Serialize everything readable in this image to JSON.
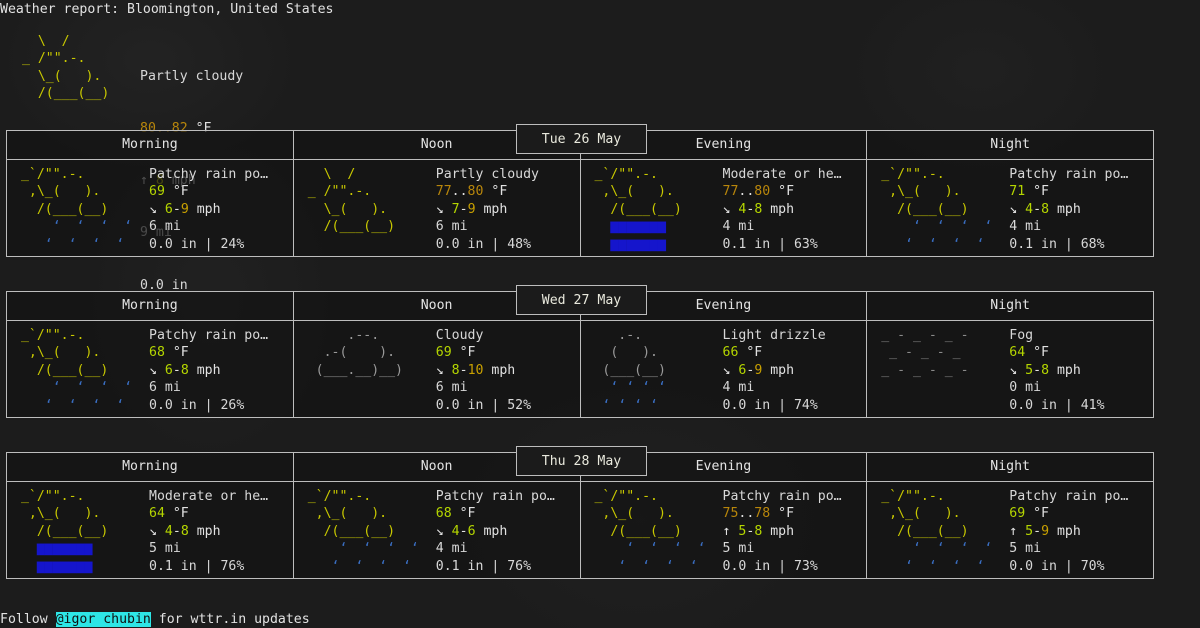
{
  "header": {
    "title": "Weather report: Bloomington, United States"
  },
  "current": {
    "art_lines": [
      "   \\  /",
      " _ /\"\".-.",
      "   \\_(   ).",
      "   /(___(__)",
      ""
    ],
    "condition": "Partly cloudy",
    "temp": "80..82",
    "temp_unit": "°F",
    "wind_arrow": "↑",
    "wind": "8",
    "wind_unit": "mph",
    "visibility": "9 mi",
    "precip": "0.0 in"
  },
  "columns": [
    "Morning",
    "Noon",
    "Evening",
    "Night"
  ],
  "days": [
    {
      "date": "Tue 26 May",
      "slots": [
        {
          "period": "Morning",
          "art_kind": "patchy-rain",
          "condition": "Patchy rain po…",
          "temp": "69",
          "temp_class": "lime",
          "temp_unit": "°F",
          "wind_arrow": "↘",
          "wind": "6-9",
          "wind_low_class": "lime",
          "wind_high_class": "amber",
          "wind_unit": "mph",
          "visibility": "6 mi",
          "precip": "0.0 in",
          "chance": "24%"
        },
        {
          "period": "Noon",
          "art_kind": "partly-cloudy",
          "condition": "Partly cloudy",
          "temp": "77..80",
          "temp_class": "gold",
          "temp_unit": "°F",
          "wind_arrow": "↘",
          "wind": "7-9",
          "wind_low_class": "lime",
          "wind_high_class": "amber",
          "wind_unit": "mph",
          "visibility": "6 mi",
          "precip": "0.0 in",
          "chance": "48%"
        },
        {
          "period": "Evening",
          "art_kind": "heavy-rain",
          "condition": "Moderate or he…",
          "temp": "77..80",
          "temp_class": "gold",
          "temp_unit": "°F",
          "wind_arrow": "↘",
          "wind": "4-8",
          "wind_low_class": "lime",
          "wind_high_class": "lime",
          "wind_unit": "mph",
          "visibility": "4 mi",
          "precip": "0.1 in",
          "chance": "63%"
        },
        {
          "period": "Night",
          "art_kind": "patchy-rain",
          "condition": "Patchy rain po…",
          "temp": "71",
          "temp_class": "lime",
          "temp_unit": "°F",
          "wind_arrow": "↘",
          "wind": "4-8",
          "wind_low_class": "lime",
          "wind_high_class": "lime",
          "wind_unit": "mph",
          "visibility": "4 mi",
          "precip": "0.1 in",
          "chance": "68%"
        }
      ]
    },
    {
      "date": "Wed 27 May",
      "slots": [
        {
          "period": "Morning",
          "art_kind": "patchy-rain",
          "condition": "Patchy rain po…",
          "temp": "68",
          "temp_class": "lime",
          "temp_unit": "°F",
          "wind_arrow": "↘",
          "wind": "6-8",
          "wind_low_class": "lime",
          "wind_high_class": "lime",
          "wind_unit": "mph",
          "visibility": "6 mi",
          "precip": "0.0 in",
          "chance": "26%"
        },
        {
          "period": "Noon",
          "art_kind": "cloudy",
          "condition": "Cloudy",
          "temp": "69",
          "temp_class": "lime",
          "temp_unit": "°F",
          "wind_arrow": "↘",
          "wind": "8-10",
          "wind_low_class": "lime",
          "wind_high_class": "amber",
          "wind_unit": "mph",
          "visibility": "6 mi",
          "precip": "0.0 in",
          "chance": "52%"
        },
        {
          "period": "Evening",
          "art_kind": "light-drizzle",
          "condition": "Light drizzle",
          "temp": "66",
          "temp_class": "lime",
          "temp_unit": "°F",
          "wind_arrow": "↘",
          "wind": "6-9",
          "wind_low_class": "lime",
          "wind_high_class": "amber",
          "wind_unit": "mph",
          "visibility": "4 mi",
          "precip": "0.0 in",
          "chance": "74%"
        },
        {
          "period": "Night",
          "art_kind": "fog",
          "condition": "Fog",
          "temp": "64",
          "temp_class": "lime",
          "temp_unit": "°F",
          "wind_arrow": "↘",
          "wind": "5-8",
          "wind_low_class": "lime",
          "wind_high_class": "lime",
          "wind_unit": "mph",
          "visibility": "0 mi",
          "precip": "0.0 in",
          "chance": "41%"
        }
      ]
    },
    {
      "date": "Thu 28 May",
      "slots": [
        {
          "period": "Morning",
          "art_kind": "heavy-rain",
          "condition": "Moderate or he…",
          "temp": "64",
          "temp_class": "lime",
          "temp_unit": "°F",
          "wind_arrow": "↘",
          "wind": "4-8",
          "wind_low_class": "lime",
          "wind_high_class": "lime",
          "wind_unit": "mph",
          "visibility": "5 mi",
          "precip": "0.1 in",
          "chance": "76%"
        },
        {
          "period": "Noon",
          "art_kind": "patchy-rain",
          "condition": "Patchy rain po…",
          "temp": "68",
          "temp_class": "lime",
          "temp_unit": "°F",
          "wind_arrow": "↘",
          "wind": "4-6",
          "wind_low_class": "lime",
          "wind_high_class": "lime",
          "wind_unit": "mph",
          "visibility": "4 mi",
          "precip": "0.1 in",
          "chance": "76%"
        },
        {
          "period": "Evening",
          "art_kind": "patchy-rain",
          "condition": "Patchy rain po…",
          "temp": "75..78",
          "temp_class": "gold",
          "temp_unit": "°F",
          "wind_arrow": "↑",
          "wind": "5-8",
          "wind_low_class": "lime",
          "wind_high_class": "lime",
          "wind_unit": "mph",
          "visibility": "5 mi",
          "precip": "0.0 in",
          "chance": "73%"
        },
        {
          "period": "Night",
          "art_kind": "patchy-rain",
          "condition": "Patchy rain po…",
          "temp": "69",
          "temp_class": "lime",
          "temp_unit": "°F",
          "wind_arrow": "↑",
          "wind": "5-9",
          "wind_low_class": "lime",
          "wind_high_class": "amber",
          "wind_unit": "mph",
          "visibility": "5 mi",
          "precip": "0.0 in",
          "chance": "70%"
        }
      ]
    }
  ],
  "footer": {
    "prefix": "Follow ",
    "handle": "@igor chubin",
    "suffix": " for wttr.in updates"
  },
  "colors": {
    "background": "#1c1c1c",
    "border": "#bdbdbd",
    "text": "#e2e2e2",
    "sun_yellow": "#c8c800",
    "temp_lime": "#b5d600",
    "temp_gold": "#b8860b",
    "wind_amber": "#c8a000",
    "rain_blue": "#1515cc",
    "drizzle_blue": "#3a6fc4",
    "cloud_grey": "#9a9a9a",
    "fog_grey": "#8a8a8a",
    "highlight_cyan": "#2ee6e6"
  }
}
